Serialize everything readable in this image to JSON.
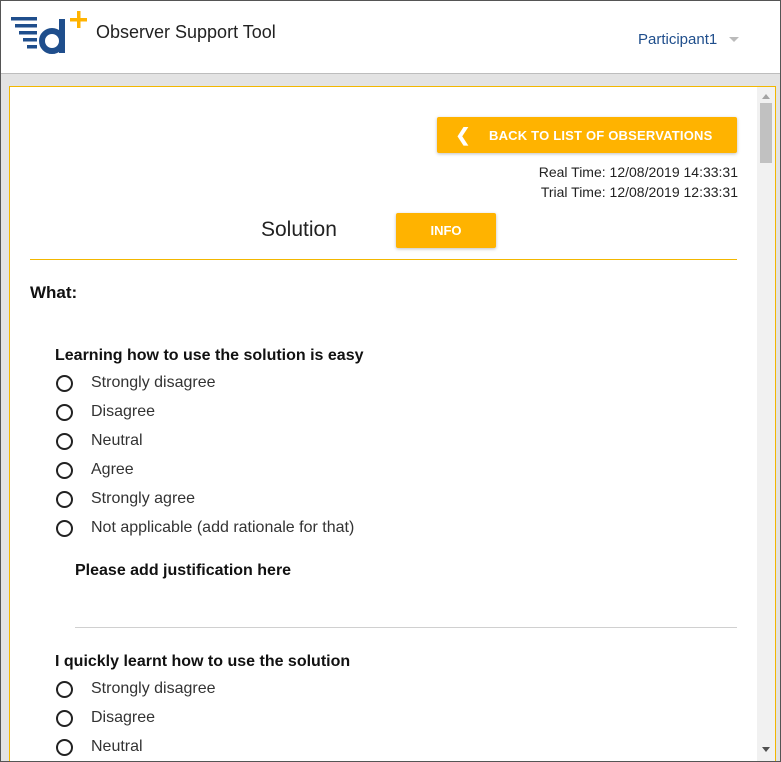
{
  "header": {
    "app_title": "Observer Support Tool",
    "user_name": "Participant1",
    "logo_icon": "d-plus-logo",
    "colors": {
      "accent": "#ffb300",
      "brand_blue": "#1f4e8c"
    }
  },
  "toolbar": {
    "back_label": "BACK TO LIST OF OBSERVATIONS",
    "back_icon": "chevron-left-icon"
  },
  "times": {
    "real_time": "Real Time: 12/08/2019 14:33:31",
    "trial_time": "Trial Time: 12/08/2019 12:33:31"
  },
  "section": {
    "title": "Solution",
    "info_label": "INFO",
    "what_label": "What:"
  },
  "questions": [
    {
      "text": "Learning how to use the solution is easy",
      "options": [
        "Strongly disagree",
        "Disagree",
        "Neutral",
        "Agree",
        "Strongly agree",
        "Not applicable (add rationale for that)"
      ],
      "justification_label": "Please add justification here",
      "justification_value": ""
    },
    {
      "text": "I quickly learnt how to use the solution",
      "options": [
        "Strongly disagree",
        "Disagree",
        "Neutral"
      ]
    }
  ]
}
